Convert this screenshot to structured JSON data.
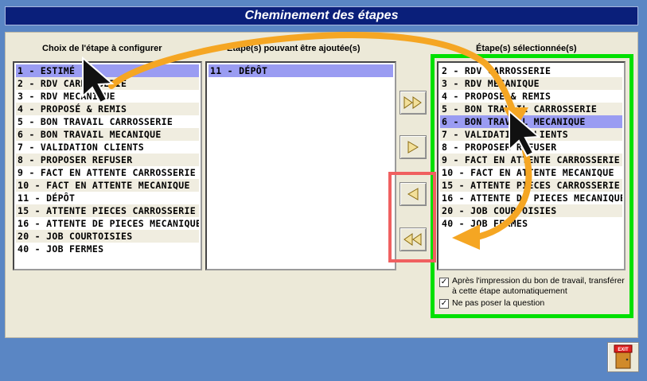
{
  "window": {
    "title": "Cheminement des étapes"
  },
  "columns": {
    "left_header": "Choix de l'étape à configurer",
    "middle_header": "Étape(s) pouvant être ajoutée(s)",
    "right_header": "Étape(s) sélectionnée(s)"
  },
  "left_list": [
    "1 - ESTIMÉ",
    "2 - RDV CARROSSERIE",
    "3 - RDV MECANIQUE",
    "4 - PROPOSÉ & REMIS",
    "5 - BON TRAVAIL CARROSSERIE",
    "6 - BON TRAVAIL MECANIQUE",
    "7 - VALIDATION CLIENTS",
    "8 - PROPOSER REFUSER",
    "9 - FACT EN ATTENTE CARROSSERIE",
    "10 - FACT EN ATTENTE MECANIQUE",
    "11 - DÉPÔT",
    "15 - ATTENTE PIECES CARROSSERIE",
    "16 - ATTENTE DE PIECES MECANIQUE",
    "20 - JOB COURTOISIES",
    "40 - JOB FERMES"
  ],
  "left_selected_index": 0,
  "middle_list": [
    "11 - DÉPÔT"
  ],
  "middle_selected_index": 0,
  "right_list": [
    "2 - RDV CARROSSERIE",
    "3 - RDV MECANIQUE",
    "4 - PROPOSÉ & REMIS",
    "5 - BON TRAVAIL CARROSSERIE",
    "6 - BON TRAVAIL MECANIQUE",
    "7 - VALIDATION CLIENTS",
    "8 - PROPOSER REFUSER",
    "9 - FACT EN ATTENTE CARROSSERIE",
    "10 - FACT EN ATTENTE MECANIQUE",
    "15 - ATTENTE PIECES CARROSSERIE",
    "16 - ATTENTE DE PIECES MECANIQUE",
    "20 - JOB COURTOISIES",
    "40 - JOB FERMES"
  ],
  "right_selected_index": 4,
  "buttons": {
    "add_all_icon": "double-chevron-right-icon",
    "add_one_icon": "chevron-right-icon",
    "remove_one_icon": "chevron-left-icon",
    "remove_all_icon": "double-chevron-left-icon"
  },
  "options": {
    "auto_transfer_label": "Après l'impression du bon de travail, transférer à cette étape automatiquement",
    "auto_transfer_checked": true,
    "no_prompt_label": "Ne pas poser la question",
    "no_prompt_checked": true
  },
  "exit": {
    "label": "EXIT"
  },
  "colors": {
    "title_bg": "#0a1f7a",
    "selection": "#9a9cf2",
    "highlight_green": "#00e000",
    "highlight_red": "#f06060",
    "annotation_arrow": "#f5a623"
  }
}
